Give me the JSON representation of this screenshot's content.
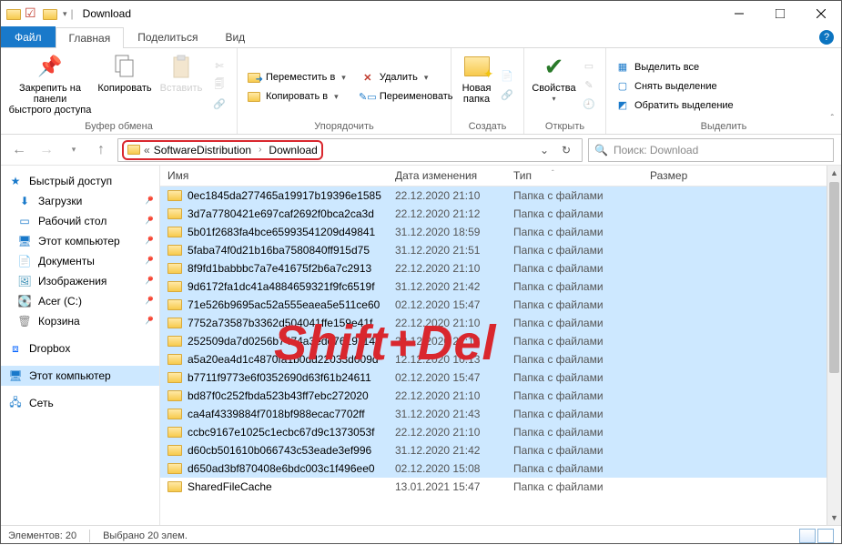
{
  "window": {
    "title": "Download"
  },
  "tabs": {
    "file": "Файл",
    "home": "Главная",
    "share": "Поделиться",
    "view": "Вид"
  },
  "ribbon": {
    "clipboard": {
      "label": "Буфер обмена",
      "pin": "Закрепить на панели\nбыстрого доступа",
      "copy": "Копировать",
      "paste": "Вставить"
    },
    "organize": {
      "label": "Упорядочить",
      "move_to": "Переместить в",
      "copy_to": "Копировать в",
      "delete": "Удалить",
      "rename": "Переименовать"
    },
    "create": {
      "label": "Создать",
      "new_folder": "Новая\nпапка"
    },
    "open": {
      "label": "Открыть",
      "properties": "Свойства"
    },
    "select": {
      "label": "Выделить",
      "select_all": "Выделить все",
      "select_none": "Снять выделение",
      "invert": "Обратить выделение"
    }
  },
  "address": {
    "crumbs": [
      "SoftwareDistribution",
      "Download"
    ],
    "search_placeholder": "Поиск: Download"
  },
  "nav": {
    "quick_access": "Быстрый доступ",
    "items": [
      {
        "label": "Загрузки"
      },
      {
        "label": "Рабочий стол"
      },
      {
        "label": "Этот компьютер"
      },
      {
        "label": "Документы"
      },
      {
        "label": "Изображения"
      },
      {
        "label": "Acer (C:)"
      },
      {
        "label": "Корзина"
      }
    ],
    "dropbox": "Dropbox",
    "this_pc": "Этот компьютер",
    "network": "Сеть"
  },
  "columns": {
    "name": "Имя",
    "date": "Дата изменения",
    "type": "Тип",
    "size": "Размер"
  },
  "type_folder": "Папка с файлами",
  "files": [
    {
      "n": "0ec1845da277465a19917b19396e1585",
      "d": "22.12.2020 21:10"
    },
    {
      "n": "3d7a7780421e697caf2692f0bca2ca3d",
      "d": "22.12.2020 21:12"
    },
    {
      "n": "5b01f2683fa4bce65993541209d49841",
      "d": "31.12.2020 18:59"
    },
    {
      "n": "5faba74f0d21b16ba7580840ff915d75",
      "d": "31.12.2020 21:51"
    },
    {
      "n": "8f9fd1babbbc7a7e41675f2b6a7c2913",
      "d": "22.12.2020 21:10"
    },
    {
      "n": "9d6172fa1dc41a4884659321f9fc6519f",
      "d": "31.12.2020 21:42"
    },
    {
      "n": "71e526b9695ac52a555eaea5e511ce60",
      "d": "02.12.2020 15:47"
    },
    {
      "n": "7752a73587b3362d504041ffe159e41f",
      "d": "22.12.2020 21:10"
    },
    {
      "n": "252509da7d0256b7474a3edd76191148",
      "d": "22.12.2020 21:12"
    },
    {
      "n": "a5a20ea4d1c4870fa1b0dd22033d009d",
      "d": "12.12.2020 10:13"
    },
    {
      "n": "b7711f9773e6f0352690d63f61b24611",
      "d": "02.12.2020 15:47"
    },
    {
      "n": "bd87f0c252fbda523b43ff7ebc272020",
      "d": "22.12.2020 21:10"
    },
    {
      "n": "ca4af4339884f7018bf988ecac7702ff",
      "d": "31.12.2020 21:43"
    },
    {
      "n": "ccbc9167e1025c1ecbc67d9c1373053f",
      "d": "22.12.2020 21:10"
    },
    {
      "n": "d60cb501610b066743c53eade3ef996",
      "d": "31.12.2020 21:42"
    },
    {
      "n": "d650ad3bf870408e6bdc003c1f496ee0",
      "d": "02.12.2020 15:08"
    },
    {
      "n": "SharedFileCache",
      "d": "13.01.2021 15:47",
      "unsel": true
    }
  ],
  "status": {
    "elements": "Элементов: 20",
    "selected": "Выбрано 20 элем."
  },
  "overlay": "Shift+Del"
}
